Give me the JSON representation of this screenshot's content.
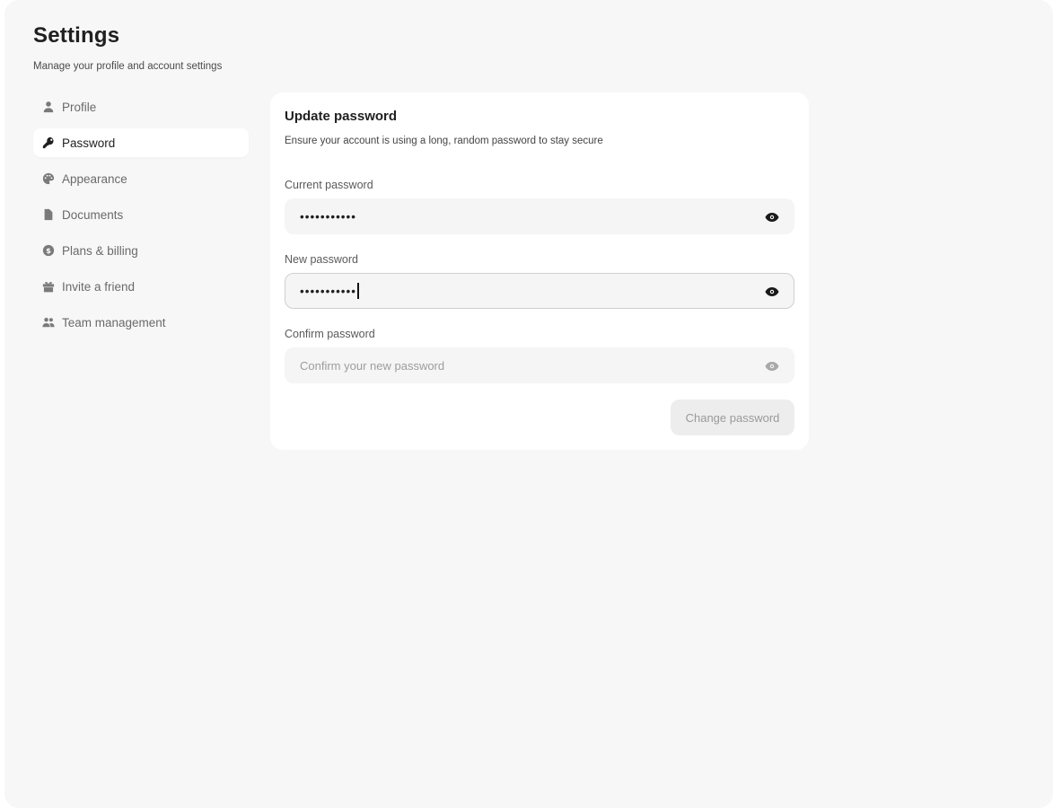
{
  "header": {
    "title": "Settings",
    "subtitle": "Manage your profile and account settings"
  },
  "sidebar": {
    "items": [
      {
        "label": "Profile",
        "icon": "user-icon"
      },
      {
        "label": "Password",
        "icon": "key-icon",
        "active": true
      },
      {
        "label": "Appearance",
        "icon": "palette-icon"
      },
      {
        "label": "Documents",
        "icon": "document-icon"
      },
      {
        "label": "Plans & billing",
        "icon": "dollar-icon"
      },
      {
        "label": "Invite a friend",
        "icon": "gift-icon"
      },
      {
        "label": "Team management",
        "icon": "users-icon"
      }
    ]
  },
  "card": {
    "title": "Update password",
    "description": "Ensure your account is using a long, random password to stay secure",
    "current": {
      "label": "Current password",
      "value": "•••••••••••"
    },
    "new": {
      "label": "New password",
      "value": "•••••••••••"
    },
    "confirm": {
      "label": "Confirm password",
      "placeholder": "Confirm your new password"
    },
    "submit_label": "Change password"
  },
  "colors": {
    "background": "#f7f7f7",
    "card": "#ffffff",
    "input": "#f5f5f5",
    "button_disabled": "#ededed"
  }
}
